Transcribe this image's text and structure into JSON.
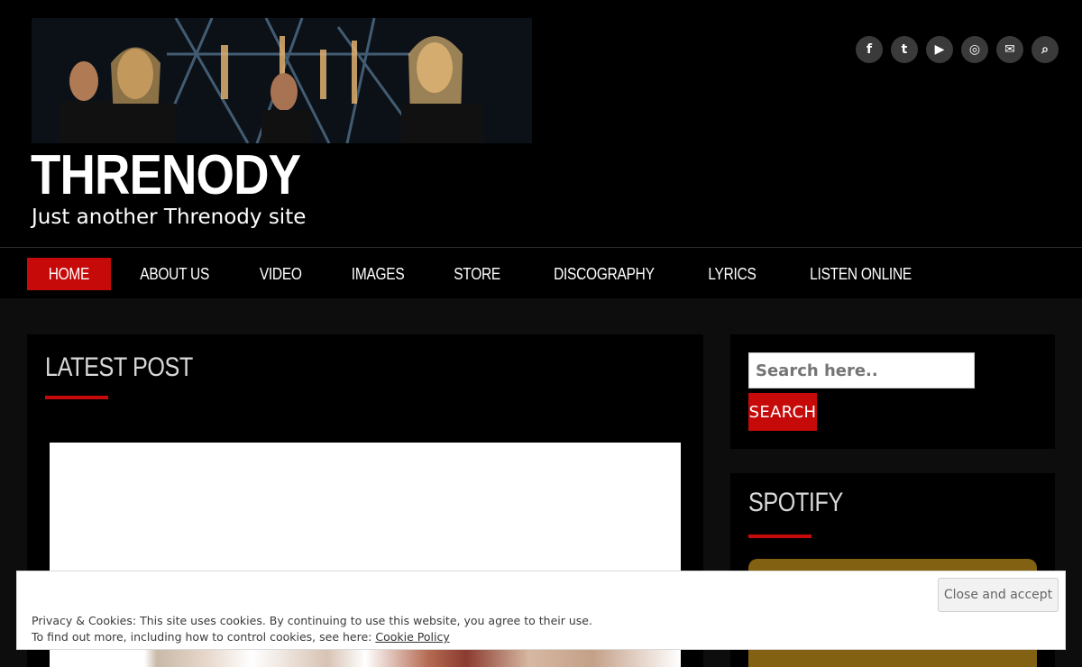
{
  "site": {
    "title": "THRENODY",
    "tagline": "Just another Threnody site"
  },
  "social": [
    {
      "icon": "facebook-icon",
      "glyph": "f"
    },
    {
      "icon": "twitter-icon",
      "glyph": "t"
    },
    {
      "icon": "youtube-icon",
      "glyph": "▶"
    },
    {
      "icon": "instagram-icon",
      "glyph": "◎"
    },
    {
      "icon": "envelope-icon",
      "glyph": "✉"
    },
    {
      "icon": "search-icon",
      "glyph": "⌕"
    }
  ],
  "nav": {
    "items": [
      {
        "label": "HOME",
        "active": true
      },
      {
        "label": "ABOUT US"
      },
      {
        "label": "VIDEO"
      },
      {
        "label": "IMAGES"
      },
      {
        "label": "STORE"
      },
      {
        "label": "DISCOGRAPHY"
      },
      {
        "label": "LYRICS"
      },
      {
        "label": "LISTEN ONLINE"
      }
    ]
  },
  "main": {
    "section_title": "LATEST POST"
  },
  "sidebar": {
    "search": {
      "placeholder": "Search here..",
      "button_label": "SEARCH"
    },
    "spotify": {
      "title": "SPOTIFY"
    }
  },
  "cookie": {
    "line1": "Privacy & Cookies: This site uses cookies. By continuing to use this website, you agree to their use.",
    "line2_prefix": "To find out more, including how to control cookies, see here: ",
    "link_label": "Cookie Policy",
    "close_label": "Close and accept"
  },
  "colors": {
    "accent": "#c60a0a",
    "background": "#000000",
    "page_background": "#0d0d0d",
    "spotify_embed": "#826212"
  }
}
